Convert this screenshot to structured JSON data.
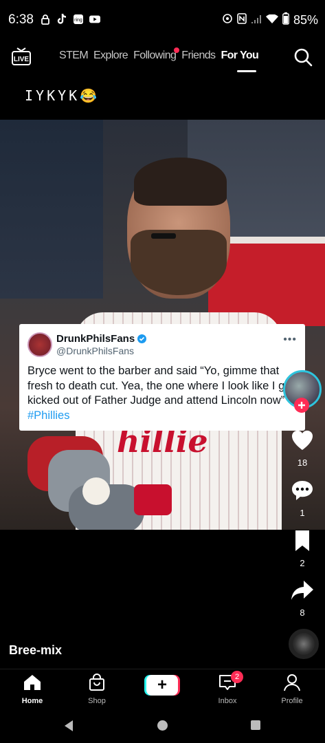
{
  "status_bar": {
    "time": "6:38",
    "battery": "85%",
    "left_icons": [
      "lock-icon",
      "tiktok-icon",
      "ring-icon",
      "youtube-icon"
    ],
    "right_icons": [
      "hotspot-icon",
      "nfc-icon",
      "signal-icon",
      "wifi-icon",
      "battery-icon"
    ]
  },
  "top_nav": {
    "live_label": "LIVE",
    "tabs": [
      {
        "label": "STEM"
      },
      {
        "label": "Explore"
      },
      {
        "label": "Following"
      },
      {
        "label": "Friends"
      },
      {
        "label": "For You"
      }
    ],
    "active_tab": "For You"
  },
  "post": {
    "caption": "IYKYK😂",
    "author": "Bree-mix",
    "likes": "18",
    "comments": "1",
    "saves": "2",
    "shares": "8"
  },
  "tweet": {
    "name": "DrunkPhilsFans",
    "handle": "@DrunkPhilsFans",
    "text": "Bryce went to the barber and said “Yo, gimme that fresh to death cut. Yea, the one where I look like I got kicked out of Father Judge and attend Lincoln now” ",
    "hashtag": "#Phillies",
    "jersey_text": "hillie"
  },
  "tabbar": {
    "home": "Home",
    "shop": "Shop",
    "create": "+",
    "inbox": "Inbox",
    "inbox_badge": "2",
    "profile": "Profile"
  },
  "colors": {
    "accent_red": "#fe2c55",
    "accent_cyan": "#25f4ee",
    "link_blue": "#1d9bf0"
  }
}
